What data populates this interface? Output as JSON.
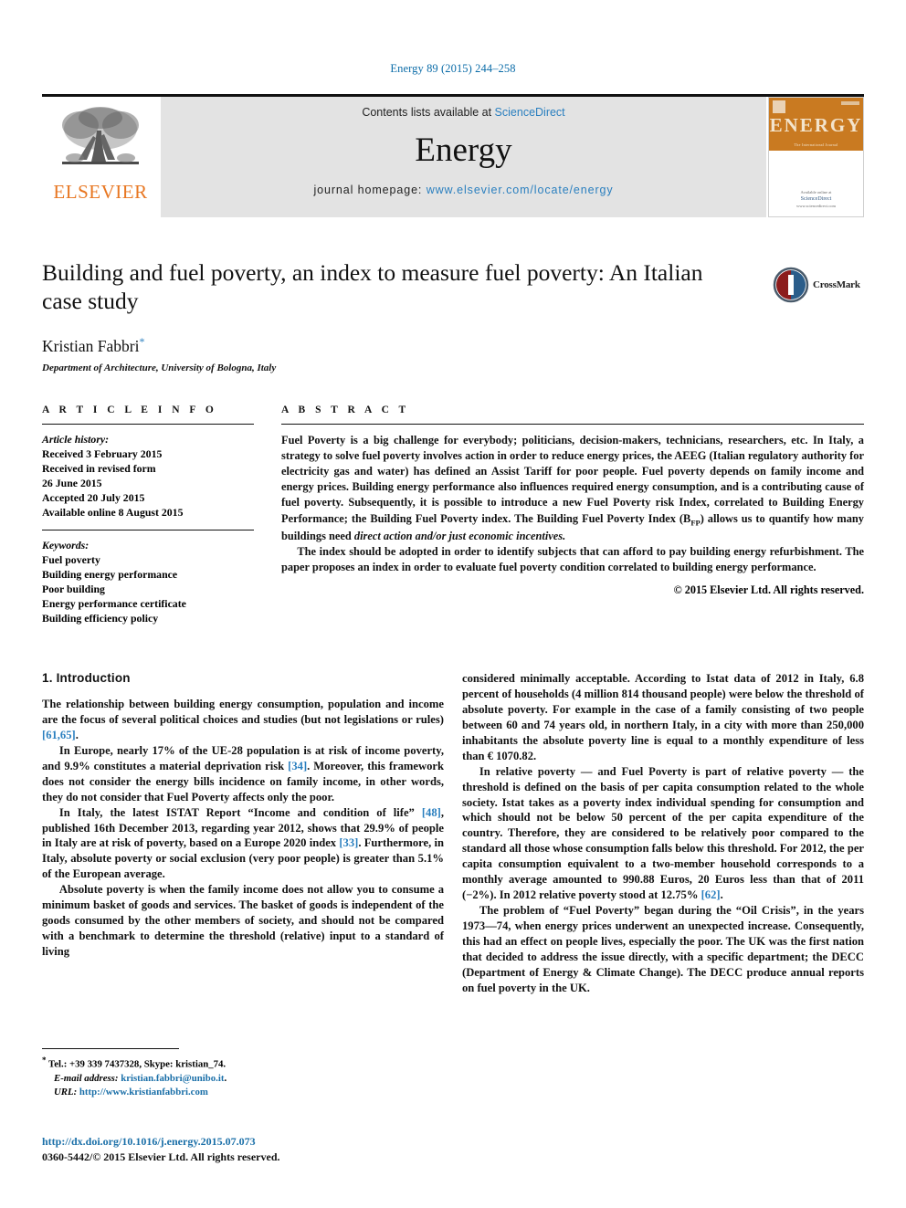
{
  "running_head": "Energy 89 (2015) 244–258",
  "masthead": {
    "publisher": "ELSEVIER",
    "contents_prefix": "Contents lists available at ",
    "contents_link": "ScienceDirect",
    "journal_name": "Energy",
    "homepage_prefix": "journal homepage: ",
    "homepage_url": "www.elsevier.com/locate/energy",
    "cover_title": "ENERGY",
    "cover_subtitle": "The International Journal",
    "cover_footer_small": "Available online at",
    "cover_footer_brand": "ScienceDirect",
    "cover_footer_url": "www.sciencedirect.com"
  },
  "article": {
    "title": "Building and fuel poverty, an index to measure fuel poverty: An Italian case study",
    "author": "Kristian Fabbri",
    "author_marker": "*",
    "affiliation": "Department of Architecture, University of Bologna, Italy",
    "crossmark_label": "CrossMark"
  },
  "article_info": {
    "heading": "A R T I C L E   I N F O",
    "history_label": "Article history:",
    "history": [
      "Received 3 February 2015",
      "Received in revised form",
      "26 June 2015",
      "Accepted 20 July 2015",
      "Available online 8 August 2015"
    ],
    "keywords_label": "Keywords:",
    "keywords": [
      "Fuel poverty",
      "Building energy performance",
      "Poor building",
      "Energy performance certificate",
      "Building efficiency policy"
    ]
  },
  "abstract": {
    "heading": "A B S T R A C T",
    "paragraph_1_a": "Fuel Poverty is a big challenge for everybody; politicians, decision-makers, technicians, researchers, etc. In Italy, a strategy to solve fuel poverty involves action in order to reduce energy prices, the AEEG (Italian regulatory authority for electricity gas and water) has defined an Assist Tariff for poor people. Fuel poverty depends on family income and energy prices. Building energy performance also influences required energy consumption, and is a contributing cause of fuel poverty. Subsequently, it is possible to introduce a new Fuel Poverty risk Index, correlated to Building Energy Performance; the Building Fuel Poverty index. The Building Fuel Poverty Index (B",
    "paragraph_1_sub": "FP",
    "paragraph_1_b": ") allows us to quantify how many buildings need ",
    "paragraph_1_italic": "direct action and/or just economic incentives.",
    "paragraph_2": "The index should be adopted in order to identify subjects that can afford to pay building energy refurbishment. The paper proposes an index in order to evaluate fuel poverty condition correlated to building energy performance.",
    "copyright": "© 2015 Elsevier Ltd. All rights reserved."
  },
  "body": {
    "section_heading": "1. Introduction",
    "left": {
      "p1_a": "The relationship between building energy consumption, population and income are the focus of several political choices and studies (but not legislations or rules) ",
      "p1_ref": "[61,65]",
      "p1_b": ".",
      "p2_a": "In Europe, nearly 17% of the UE-28 population is at risk of income poverty, and 9.9% constitutes a material deprivation risk ",
      "p2_ref": "[34]",
      "p2_b": ". Moreover, this framework does not consider the energy bills incidence on family income, in other words, they do not consider that Fuel Poverty affects only the poor.",
      "p3_a": "In Italy, the latest ISTAT Report “Income and condition of life” ",
      "p3_ref1": "[48]",
      "p3_b": ", published 16th December 2013, regarding year 2012, shows that 29.9% of people in Italy are at risk of poverty, based on a Europe 2020 index ",
      "p3_ref2": "[33]",
      "p3_c": ". Furthermore, in Italy, absolute poverty or social exclusion (very poor people) is greater than 5.1% of the European average.",
      "p4": "Absolute poverty is when the family income does not allow you to consume a minimum basket of goods and services. The basket of goods is independent of the goods consumed by the other members of society, and should not be compared with a benchmark to determine the threshold (relative) input to a standard of living"
    },
    "right": {
      "p1": "considered minimally acceptable. According to Istat data of 2012 in Italy, 6.8 percent of households (4 million 814 thousand people) were below the threshold of absolute poverty. For example in the case of a family consisting of two people between 60 and 74 years old, in northern Italy, in a city with more than 250,000 inhabitants the absolute poverty line is equal to a monthly expenditure of less than € 1070.82.",
      "p2_a": "In relative poverty — and Fuel Poverty is part of relative poverty — the threshold is defined on the basis of per capita consumption related to the whole society. Istat takes as a poverty index individual spending for consumption and which should not be below 50 percent of the per capita expenditure of the country. Therefore, they are considered to be relatively poor compared to the standard all those whose consumption falls below this threshold. For 2012, the per capita consumption equivalent to a two-member household corresponds to a monthly average amounted to 990.88 Euros, 20 Euros less than that of 2011 (−2%). In 2012 relative poverty stood at 12.75% ",
      "p2_ref": "[62]",
      "p2_b": ".",
      "p3": "The problem of “Fuel Poverty” began during the “Oil Crisis”, in the years 1973—74, when energy prices underwent an unexpected increase. Consequently, this had an effect on people lives, especially the poor. The UK was the first nation that decided to address the issue directly, with a specific department; the DECC (Department of Energy & Climate Change). The DECC produce annual reports on fuel poverty in the UK."
    }
  },
  "footnotes": {
    "star": "*",
    "tel": " Tel.: +39 339 7437328, Skype: kristian_74.",
    "email_label": "E-mail address:",
    "email": "kristian.fabbri@unibo.it",
    "email_end": ".",
    "url_label": "URL:",
    "url": "http://www.kristianfabbri.com",
    "doi": "http://dx.doi.org/10.1016/j.energy.2015.07.073",
    "issn": "0360-5442/© 2015 Elsevier Ltd. All rights reserved."
  },
  "colors": {
    "link_blue": "#2a7fbf",
    "elsevier_orange": "#E87722",
    "cover_orange": "#C97A21",
    "band_gray": "#e3e3e3"
  }
}
